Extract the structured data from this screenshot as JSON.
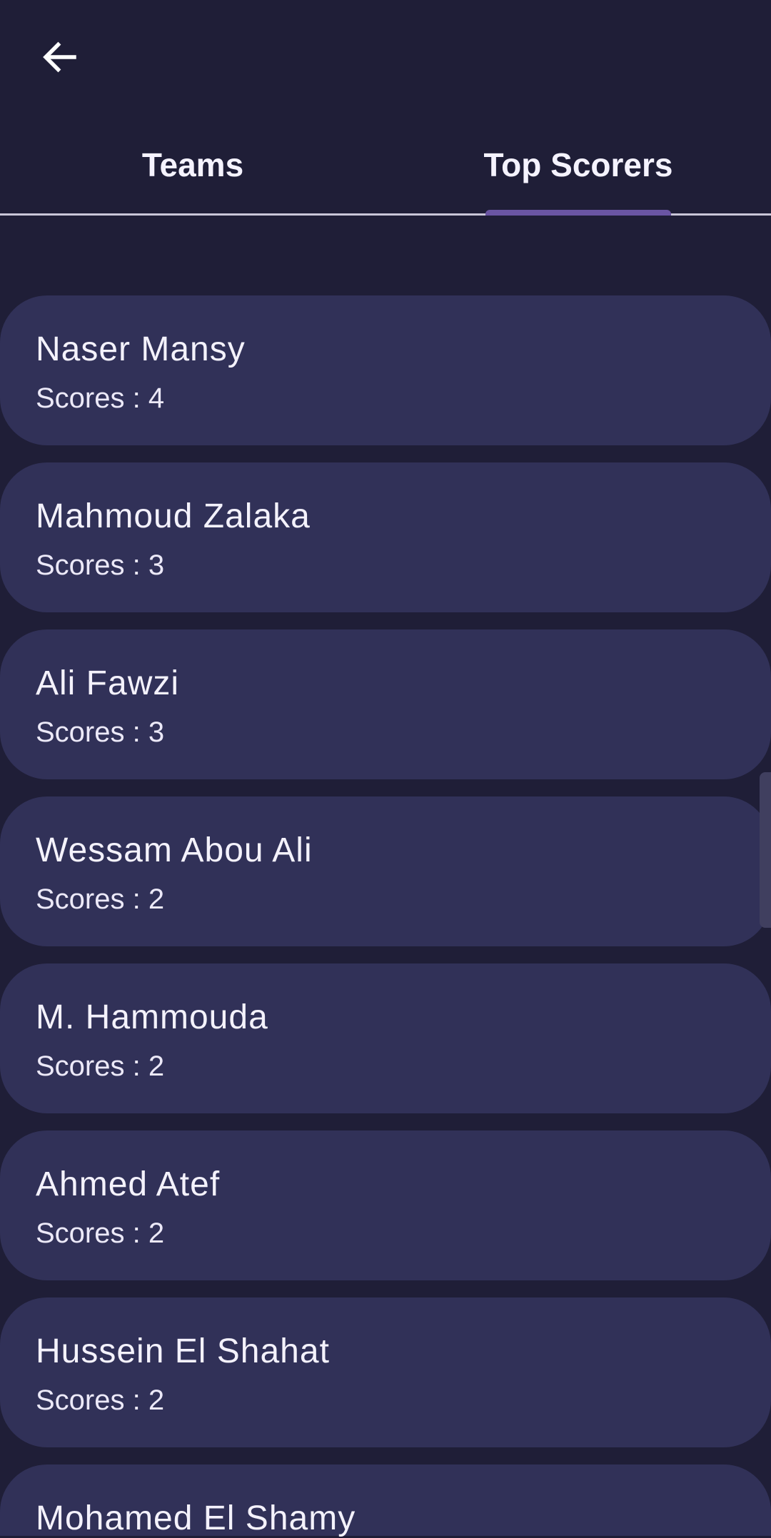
{
  "header": {
    "back_icon": "arrow-left-icon"
  },
  "tabs": [
    {
      "label": "Teams",
      "selected": false
    },
    {
      "label": "Top Scorers",
      "selected": true
    }
  ],
  "colors": {
    "background": "#1f1e37",
    "card": "#313158",
    "indicator": "#6a55a3",
    "text": "#f4f2fc"
  },
  "scorers": [
    {
      "name": "Naser Mansy",
      "score": "Scores : 4"
    },
    {
      "name": "Mahmoud Zalaka",
      "score": "Scores : 3"
    },
    {
      "name": "Ali Fawzi",
      "score": "Scores : 3"
    },
    {
      "name": "Wessam Abou Ali",
      "score": "Scores : 2"
    },
    {
      "name": "M. Hammouda",
      "score": "Scores : 2"
    },
    {
      "name": "Ahmed Atef",
      "score": "Scores : 2"
    },
    {
      "name": "Hussein El Shahat",
      "score": "Scores : 2"
    },
    {
      "name": "Mohamed El Shamy",
      "score": ""
    }
  ]
}
